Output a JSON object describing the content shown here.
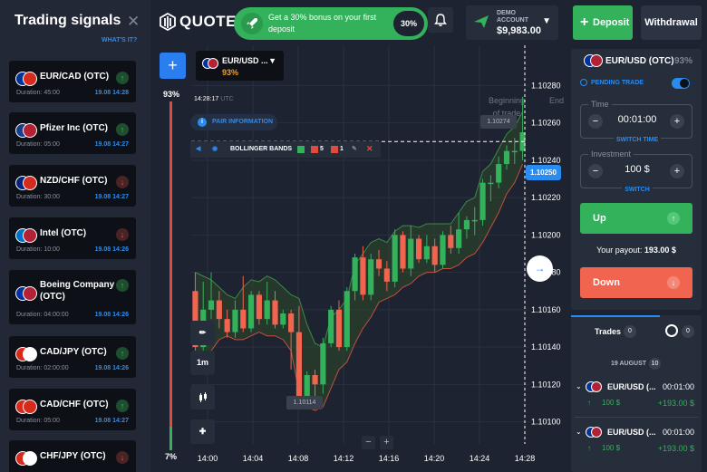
{
  "signals": {
    "title": "Trading signals",
    "what_is_it": "WHAT'S IT?",
    "items": [
      {
        "name": "EUR/CAD (OTC)",
        "duration": "Duration: 45:00",
        "time": "19.08 14:28",
        "dir": "up",
        "flags": [
          "#003399",
          "#d52b1e"
        ]
      },
      {
        "name": "Pfizer Inc (OTC)",
        "duration": "Duration: 05:00",
        "time": "19.08 14:27",
        "dir": "up",
        "flags": [
          "#1a3c8a",
          "#b22234"
        ]
      },
      {
        "name": "NZD/CHF (OTC)",
        "duration": "Duration: 30:00",
        "time": "19.08 14:27",
        "dir": "down",
        "flags": [
          "#00247d",
          "#d52b1e"
        ]
      },
      {
        "name": "Intel (OTC)",
        "duration": "Duration: 10:00",
        "time": "19.08 14:26",
        "dir": "down",
        "flags": [
          "#0071c5",
          "#b22234"
        ]
      },
      {
        "name": "Boeing Company (OTC)",
        "duration": "Duration: 04:00:00",
        "time": "19.08 14:26",
        "dir": "up",
        "flags": [
          "#0033a0",
          "#b22234"
        ]
      },
      {
        "name": "CAD/JPY (OTC)",
        "duration": "Duration: 02:00:00",
        "time": "19.08 14:26",
        "dir": "up",
        "flags": [
          "#d52b1e",
          "#ffffff"
        ]
      },
      {
        "name": "CAD/CHF (OTC)",
        "duration": "Duration: 05:00",
        "time": "19.08 14:27",
        "dir": "up",
        "flags": [
          "#d52b1e",
          "#d52b1e"
        ]
      },
      {
        "name": "CHF/JPY (OTC)",
        "duration": "",
        "time": "",
        "dir": "down",
        "flags": [
          "#d52b1e",
          "#ffffff"
        ]
      }
    ]
  },
  "topbar": {
    "logo": "QUOTEX",
    "promo_text": "Get a 30% bonus on your first deposit",
    "promo_pct": "30%",
    "account_label": "DEMO ACCOUNT",
    "balance": "$9,983.00",
    "deposit": "Deposit",
    "withdrawal": "Withdrawal"
  },
  "chart_header": {
    "asset": "EUR/USD ...",
    "asset_pct": "93%",
    "sentiment_top": "93%",
    "sentiment_bottom": "7%",
    "sentiment_up_fraction": 0.07,
    "clock": "14:28:17",
    "clock_tz": "UTC",
    "pair_info": "PAIR INFORMATION",
    "indicator_name": "BOLLINGER BANDS",
    "indicator_v1": "5",
    "indicator_v2": "1",
    "timeframe": "1m",
    "price_tag": "1.10250",
    "high_label": "1.10274",
    "low_label": "1.10114",
    "begin_label": "Beginning of trade",
    "end_label": "End"
  },
  "chart_data": {
    "type": "candlestick",
    "yticks": [
      "1.10280",
      "1.10260",
      "1.10240",
      "1.10220",
      "1.10200",
      "1.10180",
      "1.10160",
      "1.10140",
      "1.10120",
      "1.10100"
    ],
    "xticks": [
      "14:00",
      "14:04",
      "14:08",
      "14:12",
      "14:16",
      "14:20",
      "14:24",
      "14:28"
    ],
    "ylim": [
      1.10093,
      1.10287
    ],
    "candles": [
      {
        "o": 1.1017,
        "c": 1.1014,
        "h": 1.1018,
        "l": 1.1013
      },
      {
        "o": 1.1014,
        "c": 1.1016,
        "h": 1.10175,
        "l": 1.1013
      },
      {
        "o": 1.1016,
        "c": 1.10165,
        "h": 1.1018,
        "l": 1.10155
      },
      {
        "o": 1.10165,
        "c": 1.10155,
        "h": 1.1017,
        "l": 1.1015
      },
      {
        "o": 1.10155,
        "c": 1.10148,
        "h": 1.1016,
        "l": 1.10145
      },
      {
        "o": 1.10148,
        "c": 1.1016,
        "h": 1.10165,
        "l": 1.10145
      },
      {
        "o": 1.1016,
        "c": 1.1015,
        "h": 1.10178,
        "l": 1.10148
      },
      {
        "o": 1.1015,
        "c": 1.10168,
        "h": 1.1017,
        "l": 1.10148
      },
      {
        "o": 1.10168,
        "c": 1.10155,
        "h": 1.1017,
        "l": 1.10152
      },
      {
        "o": 1.10155,
        "c": 1.10165,
        "h": 1.10175,
        "l": 1.10152
      },
      {
        "o": 1.10165,
        "c": 1.10152,
        "h": 1.1017,
        "l": 1.1015
      },
      {
        "o": 1.10152,
        "c": 1.10158,
        "h": 1.1016,
        "l": 1.1015
      },
      {
        "o": 1.10158,
        "c": 1.10148,
        "h": 1.1016,
        "l": 1.10128
      },
      {
        "o": 1.10148,
        "c": 1.1011,
        "h": 1.10162,
        "l": 1.10108
      },
      {
        "o": 1.1011,
        "c": 1.10125,
        "h": 1.10127,
        "l": 1.10108
      },
      {
        "o": 1.10125,
        "c": 1.1012,
        "h": 1.10128,
        "l": 1.10112
      },
      {
        "o": 1.1012,
        "c": 1.10142,
        "h": 1.10145,
        "l": 1.10115
      },
      {
        "o": 1.10142,
        "c": 1.1016,
        "h": 1.10162,
        "l": 1.1014
      },
      {
        "o": 1.1016,
        "c": 1.1014,
        "h": 1.10165,
        "l": 1.10138
      },
      {
        "o": 1.1014,
        "c": 1.1017,
        "h": 1.10172,
        "l": 1.10138
      },
      {
        "o": 1.1017,
        "c": 1.10188,
        "h": 1.1019,
        "l": 1.10165
      },
      {
        "o": 1.10188,
        "c": 1.10168,
        "h": 1.10194,
        "l": 1.10165
      },
      {
        "o": 1.10168,
        "c": 1.10187,
        "h": 1.1019,
        "l": 1.10165
      },
      {
        "o": 1.10187,
        "c": 1.10182,
        "h": 1.10192,
        "l": 1.10178
      },
      {
        "o": 1.10182,
        "c": 1.10175,
        "h": 1.10186,
        "l": 1.1017
      },
      {
        "o": 1.10175,
        "c": 1.102,
        "h": 1.10203,
        "l": 1.10172
      },
      {
        "o": 1.102,
        "c": 1.10182,
        "h": 1.10202,
        "l": 1.1018
      },
      {
        "o": 1.10182,
        "c": 1.10198,
        "h": 1.10205,
        "l": 1.10178
      },
      {
        "o": 1.10198,
        "c": 1.10187,
        "h": 1.102,
        "l": 1.10185
      },
      {
        "o": 1.10187,
        "c": 1.10194,
        "h": 1.102,
        "l": 1.10185
      },
      {
        "o": 1.10194,
        "c": 1.10184,
        "h": 1.10198,
        "l": 1.1018
      },
      {
        "o": 1.10184,
        "c": 1.102,
        "h": 1.10202,
        "l": 1.10182
      },
      {
        "o": 1.102,
        "c": 1.10193,
        "h": 1.10205,
        "l": 1.1019
      },
      {
        "o": 1.10193,
        "c": 1.10203,
        "h": 1.10212,
        "l": 1.1019
      },
      {
        "o": 1.10203,
        "c": 1.10208,
        "h": 1.1021,
        "l": 1.10198
      },
      {
        "o": 1.10208,
        "c": 1.10208,
        "h": 1.10215,
        "l": 1.102
      },
      {
        "o": 1.10208,
        "c": 1.10228,
        "h": 1.1023,
        "l": 1.10205
      },
      {
        "o": 1.10228,
        "c": 1.10228,
        "h": 1.10232,
        "l": 1.10218
      },
      {
        "o": 1.10228,
        "c": 1.10238,
        "h": 1.10242,
        "l": 1.10225
      },
      {
        "o": 1.10238,
        "c": 1.10245,
        "h": 1.10248,
        "l": 1.10235
      },
      {
        "o": 1.10245,
        "c": 1.10245,
        "h": 1.10252,
        "l": 1.10238
      },
      {
        "o": 1.10245,
        "c": 1.10255,
        "h": 1.10274,
        "l": 1.1024
      }
    ],
    "upper_band": [
      1.1018,
      1.10178,
      1.10176,
      1.10172,
      1.10168,
      1.10166,
      1.10172,
      1.10176,
      1.10175,
      1.10178,
      1.10176,
      1.10172,
      1.10168,
      1.10166,
      1.10152,
      1.10142,
      1.1014,
      1.10156,
      1.1016,
      1.10166,
      1.10184,
      1.1019,
      1.10196,
      1.10198,
      1.10196,
      1.10202,
      1.10205,
      1.10205,
      1.10204,
      1.10206,
      1.10206,
      1.10206,
      1.10206,
      1.10212,
      1.10218,
      1.1022,
      1.10234,
      1.10238,
      1.10246,
      1.10254,
      1.10258,
      1.10266
    ],
    "lower_band": [
      1.1013,
      1.10132,
      1.10138,
      1.10144,
      1.10146,
      1.10144,
      1.10144,
      1.10146,
      1.10148,
      1.10146,
      1.10146,
      1.10144,
      1.10138,
      1.10116,
      1.10108,
      1.10106,
      1.10108,
      1.10118,
      1.10128,
      1.10132,
      1.10142,
      1.1015,
      1.10156,
      1.10164,
      1.10166,
      1.10168,
      1.10172,
      1.10174,
      1.10178,
      1.1018,
      1.1018,
      1.10182,
      1.10182,
      1.10184,
      1.10188,
      1.1019,
      1.10196,
      1.10204,
      1.10212,
      1.10222,
      1.10228,
      1.10238
    ],
    "current_price": 1.1025
  },
  "trade_panel": {
    "asset": "EUR/USD (OTC)",
    "asset_pct": "93%",
    "pending": "PENDING TRADE",
    "time_label": "Time",
    "time_value": "00:01:00",
    "switch_time": "SWITCH TIME",
    "investment_label": "Investment",
    "investment_value": "100 $",
    "switch": "SWITCH",
    "up": "Up",
    "down": "Down",
    "payout_label": "Your payout:",
    "payout_value": "193.00 $"
  },
  "trades": {
    "title": "Trades",
    "count": "0",
    "count2": "0",
    "date": "19 AUGUST",
    "date_count": "10",
    "rows": [
      {
        "name": "EUR/USD (...",
        "duration": "00:01:00",
        "amount": "100 $",
        "payout": "+193.00 $"
      },
      {
        "name": "EUR/USD (...",
        "duration": "00:01:00",
        "amount": "100 $",
        "payout": "+193.00 $"
      }
    ]
  },
  "colors": {
    "up": "#33b15b",
    "down": "#f06450",
    "accent": "#2a8cf0",
    "bg": "#1d2330"
  }
}
